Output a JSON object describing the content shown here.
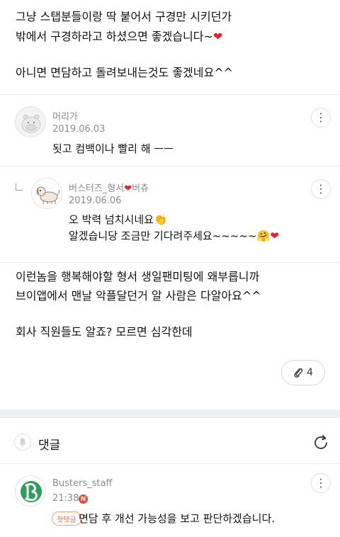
{
  "post": {
    "lines": [
      "그냥 스탭분들이랑 딱 붙어서 구경만 시키던가",
      "밖에서 구경하라고 하셨으면 좋겠습니다~",
      "아니면 면담하고 돌려보내는것도 좋겠네요^^"
    ],
    "heart": "❤"
  },
  "comments": [
    {
      "author": "머리가",
      "date": "2019.06.03",
      "text": "됫고 컴백이나 빨리 해 ㅡㅡ",
      "more": "⋮"
    },
    {
      "author_prefix": "버스터즈_형서",
      "author_heart": "❤",
      "author_suffix": "버츄",
      "date": "2019.06.06",
      "line1": "오 박력 넘치시네요",
      "line1_emoji": "👏",
      "line2": "알겠습니당 조금만 기다려주세요~~~~~",
      "line2_emoji": "🤗",
      "line2_heart": "❤",
      "more": "⋮"
    }
  ],
  "reply_body": [
    "이런놈을 행복해야할 형서 생일팬미팅에 왜부릅니까",
    "브이앱에서 맨날 악플달던거 알 사람은 다알아요^^",
    "회사 직원들도 알죠? 모르면 심각한데"
  ],
  "attach": {
    "icon": "paperclip-icon",
    "count": "4"
  },
  "comments_section": {
    "title": "댓글",
    "bell_icon": "bell-icon",
    "refresh_icon": "refresh-icon"
  },
  "staff_comment": {
    "author": "Busters_staff",
    "time": "21:38",
    "new_badge": "N",
    "tag": "첫댓글",
    "text": "면담 후 개선 가능성을 보고 판단하겠습니다.",
    "more": "⋮"
  },
  "colors": {
    "accent": "#e2232e",
    "band": "#eceff1",
    "badge": "#e44a3c",
    "logo": "#2e9e5b"
  }
}
